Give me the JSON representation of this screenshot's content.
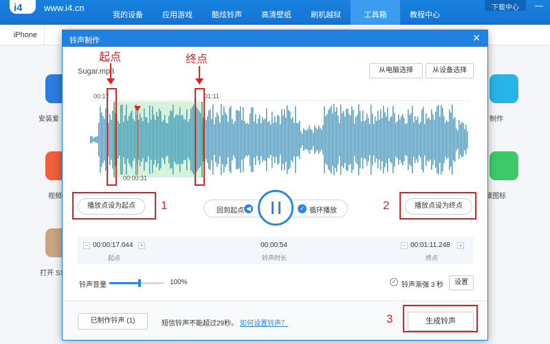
{
  "topbar": {
    "logo": "i4",
    "site": "www.i4.cn",
    "nav": [
      "我的设备",
      "应用游戏",
      "酷炫铃声",
      "高清壁纸",
      "刷机越狱",
      "工具箱",
      "教程中心"
    ],
    "active_index": 5,
    "download": "下载中心"
  },
  "background": {
    "device_tab": "iPhone",
    "left_labels": [
      "安装爱",
      "视频",
      "打开 SS"
    ],
    "right_labels": [
      "制作",
      "藏图标"
    ]
  },
  "dialog": {
    "title": "铃声制作",
    "filename": "Sugar.mp3",
    "btn_from_pc": "从电脑选择",
    "btn_from_device": "从设备选择",
    "time_start_marker": "00:17",
    "time_end_marker": "01:11",
    "time_play_marker": "00:00:31",
    "btn_set_start": "播放点设为起点",
    "btn_set_end": "播放点设为终点",
    "back_to_start": "回到起点",
    "loop_play": "循环播放",
    "start_value": "00:00:17.044",
    "start_label": "起点",
    "duration_value": "00:00:54",
    "duration_label": "铃声时长",
    "end_value": "00:01:11.248",
    "end_label": "终点",
    "volume_label": "铃声音量",
    "volume_percent": "100%",
    "volume_level": 0.55,
    "fade_label": "铃声渐强 3 秒",
    "settings_btn": "设置",
    "made_ringtones_btn": "已制作铃声 (1)",
    "limit_text": "短信铃声不能超过29秒。",
    "how_to_link": "如何设置铃声？",
    "generate_btn": "生成铃声"
  },
  "annotations": {
    "start_label": "起点",
    "end_label": "终点",
    "num1": "1",
    "num2": "2",
    "num3": "3"
  },
  "colors": {
    "accent": "#1f82e2",
    "wave": "#1aa4e8",
    "selection": "#d5f3da",
    "annotation": "#e02020"
  }
}
